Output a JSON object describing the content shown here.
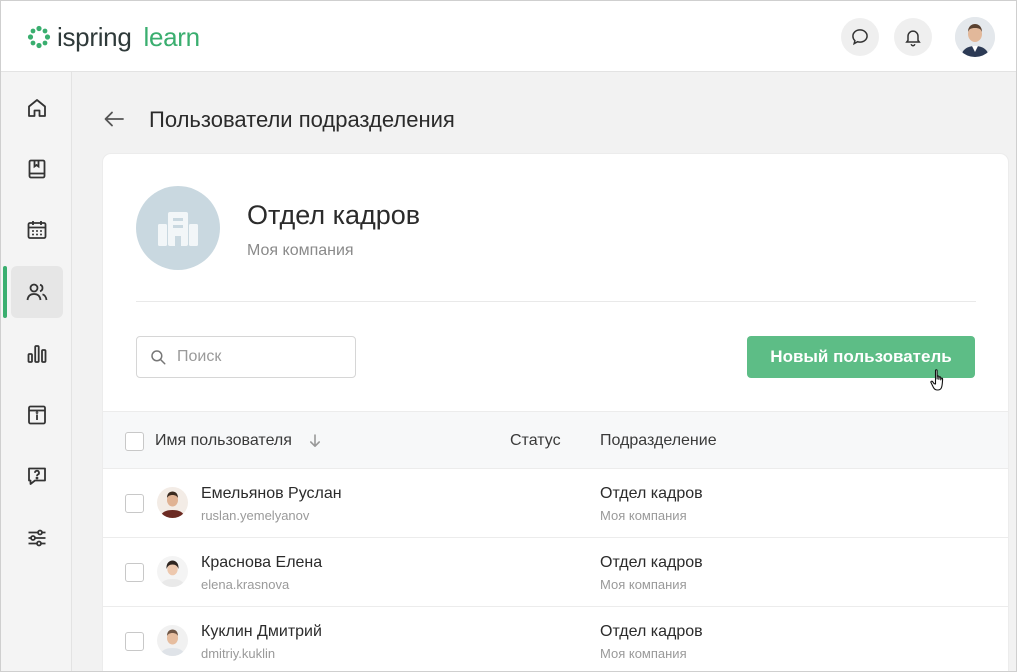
{
  "header": {
    "logo_part1": "ispring",
    "logo_part2": "learn",
    "icons": [
      "chat-icon",
      "bell-icon",
      "user-avatar"
    ]
  },
  "sidebar": {
    "items": [
      {
        "name": "home",
        "icon": "home-icon"
      },
      {
        "name": "courses",
        "icon": "book-icon"
      },
      {
        "name": "calendar",
        "icon": "calendar-icon"
      },
      {
        "name": "users",
        "icon": "users-icon",
        "active": true
      },
      {
        "name": "reports",
        "icon": "bar-chart-icon"
      },
      {
        "name": "info",
        "icon": "info-icon"
      },
      {
        "name": "help",
        "icon": "question-icon"
      },
      {
        "name": "settings",
        "icon": "sliders-icon"
      }
    ]
  },
  "page": {
    "title": "Пользователи подразделения"
  },
  "department": {
    "name": "Отдел кадров",
    "company": "Моя компания"
  },
  "toolbar": {
    "search_placeholder": "Поиск",
    "new_user_label": "Новый пользователь"
  },
  "table": {
    "columns": {
      "name": "Имя пользователя",
      "status": "Статус",
      "department": "Подразделение"
    },
    "rows": [
      {
        "name": "Емельянов Руслан",
        "login": "ruslan.yemelyanov",
        "department": "Отдел кадров",
        "company": "Моя компания"
      },
      {
        "name": "Краснова Елена",
        "login": "elena.krasnova",
        "department": "Отдел кадров",
        "company": "Моя компания"
      },
      {
        "name": "Куклин Дмитрий",
        "login": "dmitriy.kuklin",
        "department": "Отдел кадров",
        "company": "Моя компания"
      }
    ]
  },
  "colors": {
    "accent": "#3aae6f",
    "button": "#5dbd86"
  }
}
